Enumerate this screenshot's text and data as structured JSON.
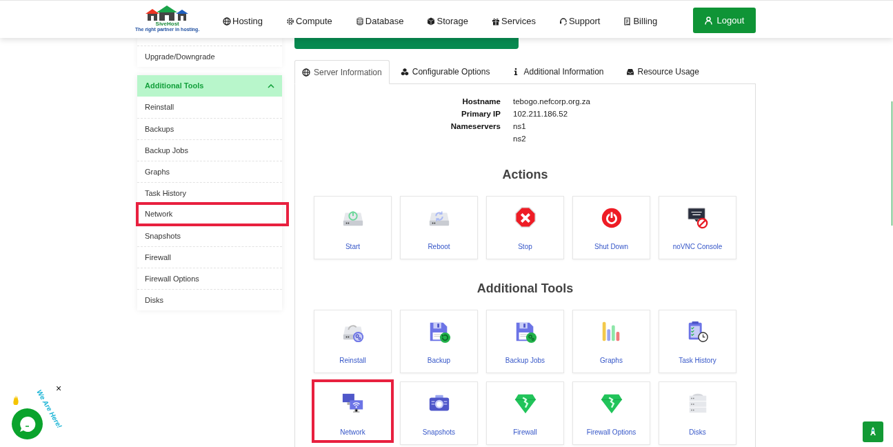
{
  "header": {
    "logo": {
      "name": "SiveHost",
      "tagline": "The right partner in hosting."
    },
    "nav": [
      {
        "label": "Hosting"
      },
      {
        "label": "Compute"
      },
      {
        "label": "Database"
      },
      {
        "label": "Storage"
      },
      {
        "label": "Services"
      },
      {
        "label": "Support"
      },
      {
        "label": "Billing"
      }
    ],
    "logout": "Logout"
  },
  "sidebar": {
    "top_items": [
      {
        "label": "Upgrade/Downgrade"
      }
    ],
    "panel": {
      "title": "Additional Tools",
      "expanded": true,
      "items": [
        {
          "label": "Reinstall",
          "highlighted": false
        },
        {
          "label": "Backups",
          "highlighted": false
        },
        {
          "label": "Backup Jobs",
          "highlighted": false
        },
        {
          "label": "Graphs",
          "highlighted": false
        },
        {
          "label": "Task History",
          "highlighted": false
        },
        {
          "label": "Network",
          "highlighted": true
        },
        {
          "label": "Snapshots",
          "highlighted": false
        },
        {
          "label": "Firewall",
          "highlighted": false
        },
        {
          "label": "Firewall Options",
          "highlighted": false
        },
        {
          "label": "Disks",
          "highlighted": false
        }
      ]
    }
  },
  "tabs": [
    {
      "label": "Server Information",
      "selected": true
    },
    {
      "label": "Configurable Options",
      "selected": false
    },
    {
      "label": "Additional Information",
      "selected": false
    },
    {
      "label": "Resource Usage",
      "selected": false
    }
  ],
  "server_info": [
    {
      "label": "Hostname",
      "values": [
        "tebogo.nefcorp.org.za"
      ]
    },
    {
      "label": "Primary IP",
      "values": [
        "102.211.186.52"
      ]
    },
    {
      "label": "Nameservers",
      "values": [
        "ns1",
        "ns2"
      ]
    }
  ],
  "sections": [
    {
      "title": "Actions",
      "tiles": [
        {
          "label": "Start",
          "highlighted": false
        },
        {
          "label": "Reboot",
          "highlighted": false
        },
        {
          "label": "Stop",
          "highlighted": false
        },
        {
          "label": "Shut Down",
          "highlighted": false
        },
        {
          "label": "noVNC Console",
          "highlighted": false
        }
      ]
    },
    {
      "title": "Additional Tools",
      "tiles": [
        {
          "label": "Reinstall",
          "highlighted": false
        },
        {
          "label": "Backup",
          "highlighted": false
        },
        {
          "label": "Backup Jobs",
          "highlighted": false
        },
        {
          "label": "Graphs",
          "highlighted": false
        },
        {
          "label": "Task History",
          "highlighted": false
        },
        {
          "label": "Network",
          "highlighted": true
        },
        {
          "label": "Snapshots",
          "highlighted": false
        },
        {
          "label": "Firewall",
          "highlighted": false
        },
        {
          "label": "Firewall Options",
          "highlighted": false
        },
        {
          "label": "Disks",
          "highlighted": false
        }
      ]
    }
  ],
  "chat_widget": {
    "caption": "We Are Here!",
    "close": "×"
  }
}
